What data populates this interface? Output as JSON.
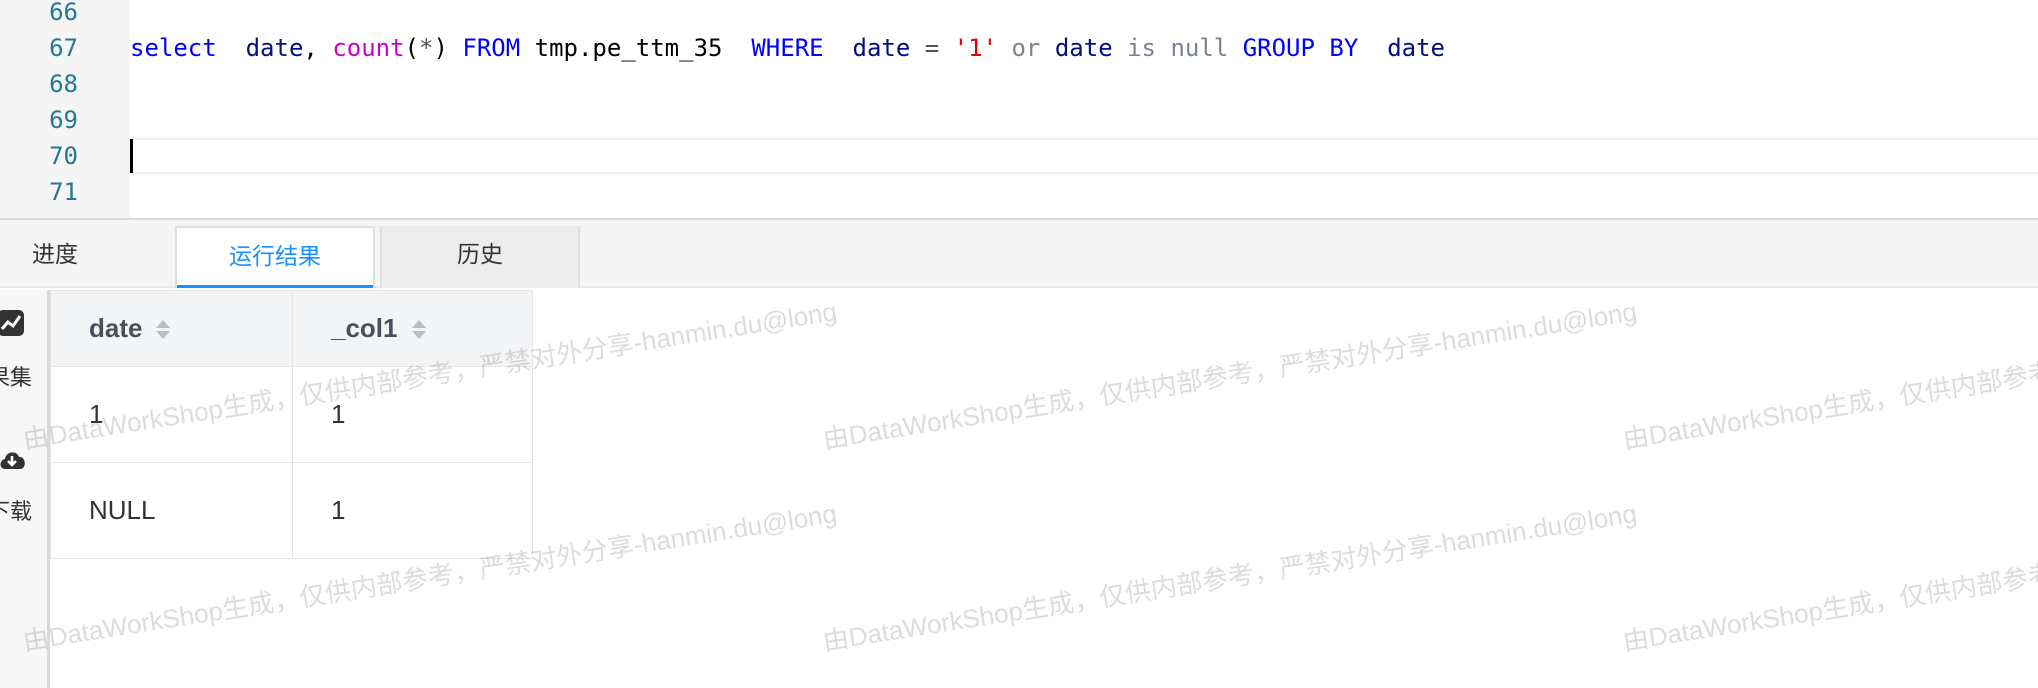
{
  "editor": {
    "lines": [
      {
        "num": "66",
        "code": ""
      },
      {
        "num": "67",
        "tokens": [
          {
            "t": "select",
            "c": "kw"
          },
          {
            "t": "  ",
            "c": "plain"
          },
          {
            "t": "date",
            "c": "id"
          },
          {
            "t": ", ",
            "c": "plain"
          },
          {
            "t": "count",
            "c": "fn"
          },
          {
            "t": "(",
            "c": "plain"
          },
          {
            "t": "*",
            "c": "op"
          },
          {
            "t": ") ",
            "c": "plain"
          },
          {
            "t": "FROM",
            "c": "kw"
          },
          {
            "t": " tmp.pe_ttm_35  ",
            "c": "plain"
          },
          {
            "t": "WHERE",
            "c": "kw"
          },
          {
            "t": "  ",
            "c": "plain"
          },
          {
            "t": "date",
            "c": "id"
          },
          {
            "t": " = ",
            "c": "op"
          },
          {
            "t": "'1'",
            "c": "str"
          },
          {
            "t": " ",
            "c": "plain"
          },
          {
            "t": "or",
            "c": "gray"
          },
          {
            "t": " ",
            "c": "plain"
          },
          {
            "t": "date",
            "c": "id"
          },
          {
            "t": " ",
            "c": "plain"
          },
          {
            "t": "is",
            "c": "gray"
          },
          {
            "t": " ",
            "c": "plain"
          },
          {
            "t": "null",
            "c": "gray"
          },
          {
            "t": " ",
            "c": "plain"
          },
          {
            "t": "GROUP BY",
            "c": "kw"
          },
          {
            "t": "  ",
            "c": "plain"
          },
          {
            "t": "date",
            "c": "id"
          }
        ]
      },
      {
        "num": "68",
        "code": ""
      },
      {
        "num": "69",
        "code": ""
      },
      {
        "num": "70",
        "code": ""
      },
      {
        "num": "71",
        "code": ""
      }
    ],
    "current_line": "70"
  },
  "tabs": [
    {
      "label": "进度"
    },
    {
      "label": "运行结果"
    },
    {
      "label": "历史"
    }
  ],
  "active_tab": "运行结果",
  "sidebar": {
    "items": [
      {
        "label": "果集",
        "icon": "chart-icon"
      },
      {
        "label": "下载",
        "icon": "cloud-download-icon"
      }
    ]
  },
  "results": {
    "columns": [
      "date",
      "_col1"
    ],
    "rows": [
      [
        "1",
        "1"
      ],
      [
        "NULL",
        "1"
      ]
    ]
  },
  "watermark": {
    "text_a": "由DataWorkShop生成，仅供内部参考，严禁对外分享-hanmin.du@long",
    "text_b": "由DataWorkShop生成，仅供内部参考，"
  },
  "colors": {
    "accent": "#1890ff",
    "keyword": "#0000ff",
    "function": "#ce00ce",
    "string": "#e00000",
    "line_number": "#237893"
  }
}
